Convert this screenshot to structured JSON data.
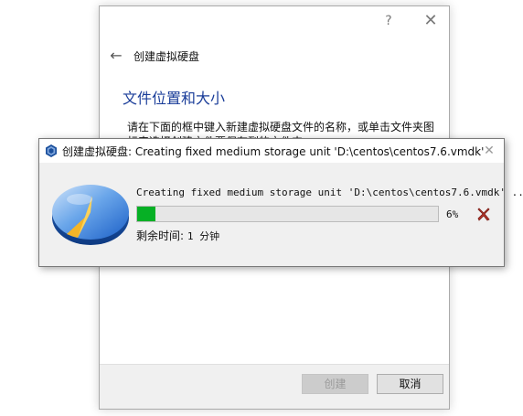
{
  "wizard": {
    "help_label": "?",
    "close_label": "✕",
    "back_label": "←",
    "title": "创建虚拟硬盘",
    "heading": "文件位置和大小",
    "description": "请在下面的框中键入新建虚拟硬盘文件的名称，或单击文件夹图标来选择创建文件要保存到的文件夹。",
    "buttons": {
      "create": "创建",
      "cancel": "取消"
    }
  },
  "progress_dialog": {
    "title": "创建虚拟硬盘: Creating fixed medium storage unit 'D:\\centos\\centos7.6.vmdk'",
    "close_label": "✕",
    "operation": "Creating fixed medium storage unit 'D:\\centos\\centos7.6.vmdk' ...",
    "progress_fraction": 0.06,
    "progress_text": "6%",
    "time_label": "剩余时间:",
    "time_value": "1 分钟",
    "accent_color": "#06b025"
  },
  "icons": {
    "app": "virtualbox-icon",
    "disk": "hard-disk-progress-icon",
    "cancel": "cancel-operation-icon"
  }
}
